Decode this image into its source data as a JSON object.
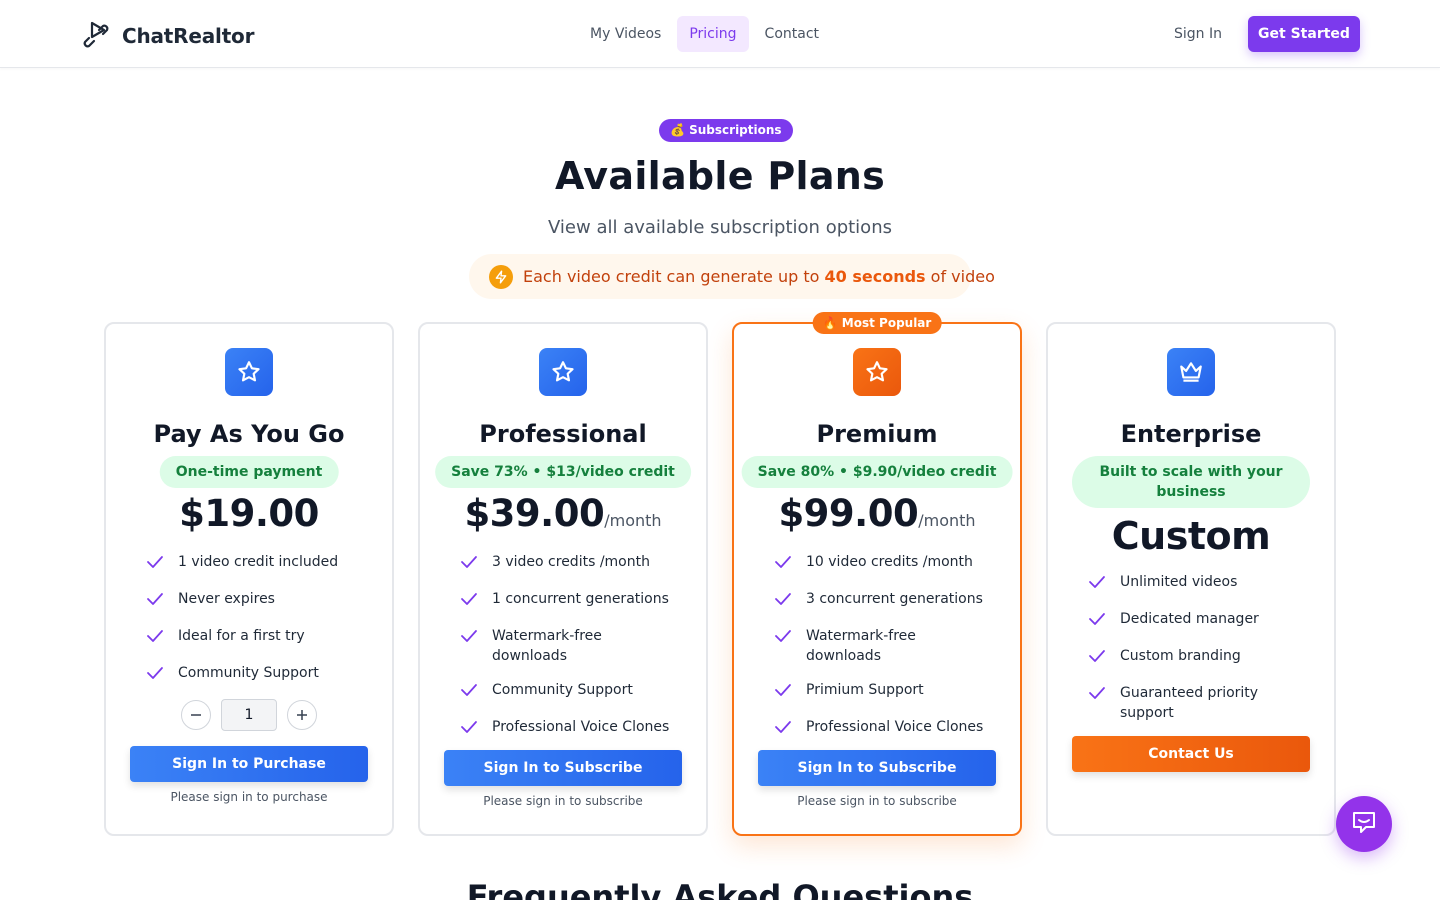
{
  "header": {
    "brand": "ChatRealtor",
    "nav": [
      {
        "label": "My Videos",
        "active": false
      },
      {
        "label": "Pricing",
        "active": true
      },
      {
        "label": "Contact",
        "active": false
      }
    ],
    "sign_in": "Sign In",
    "get_started": "Get Started"
  },
  "hero": {
    "badge": "💰 Subscriptions",
    "title": "Available Plans",
    "subtitle": "View all available subscription options",
    "credit_note_pre": "Each video credit can generate up to",
    "credit_note_bold": "40 seconds",
    "credit_note_post": "of video"
  },
  "plans": [
    {
      "name": "Pay As You Go",
      "tag": "One-time payment",
      "price": "$19.00",
      "period": "",
      "features": [
        "1 video credit included",
        "Never expires",
        "Ideal for a first try",
        "Community Support"
      ],
      "quantity": "1",
      "cta": "Sign In to Purchase",
      "note": "Please sign in to purchase"
    },
    {
      "name": "Professional",
      "tag": "Save 73% • $13/video credit",
      "price": "$39.00",
      "period": "/month",
      "features": [
        "3 video credits /month",
        "1 concurrent generations",
        "Watermark-free downloads",
        "Community Support",
        "Professional Voice Clones"
      ],
      "cta": "Sign In to Subscribe",
      "note": "Please sign in to subscribe"
    },
    {
      "name": "Premium",
      "badge": "🔥 Most Popular",
      "tag": "Save 80% • $9.90/video credit",
      "price": "$99.00",
      "period": "/month",
      "features": [
        "10 video credits /month",
        "3 concurrent generations",
        "Watermark-free downloads",
        "Primium Support",
        "Professional Voice Clones"
      ],
      "cta": "Sign In to Subscribe",
      "note": "Please sign in to subscribe"
    },
    {
      "name": "Enterprise",
      "tag": "Built to scale with your business",
      "price": "Custom",
      "features": [
        "Unlimited videos",
        "Dedicated manager",
        "Custom branding",
        "Guaranteed priority support"
      ],
      "cta": "Contact Us"
    }
  ],
  "faq_title": "Frequently Asked Questions",
  "colors": {
    "brand_purple": "#7c3aed",
    "accent_orange": "#f97316",
    "cta_blue": "#2563eb",
    "tag_green_bg": "#dcfce7",
    "tag_green_text": "#15803d"
  },
  "icons": {
    "logo": "play-link-icon",
    "plan_star": "star-icon",
    "plan_crown": "crown-icon",
    "feature": "check-icon",
    "credit": "lightning-icon",
    "chat": "chat-icon"
  }
}
